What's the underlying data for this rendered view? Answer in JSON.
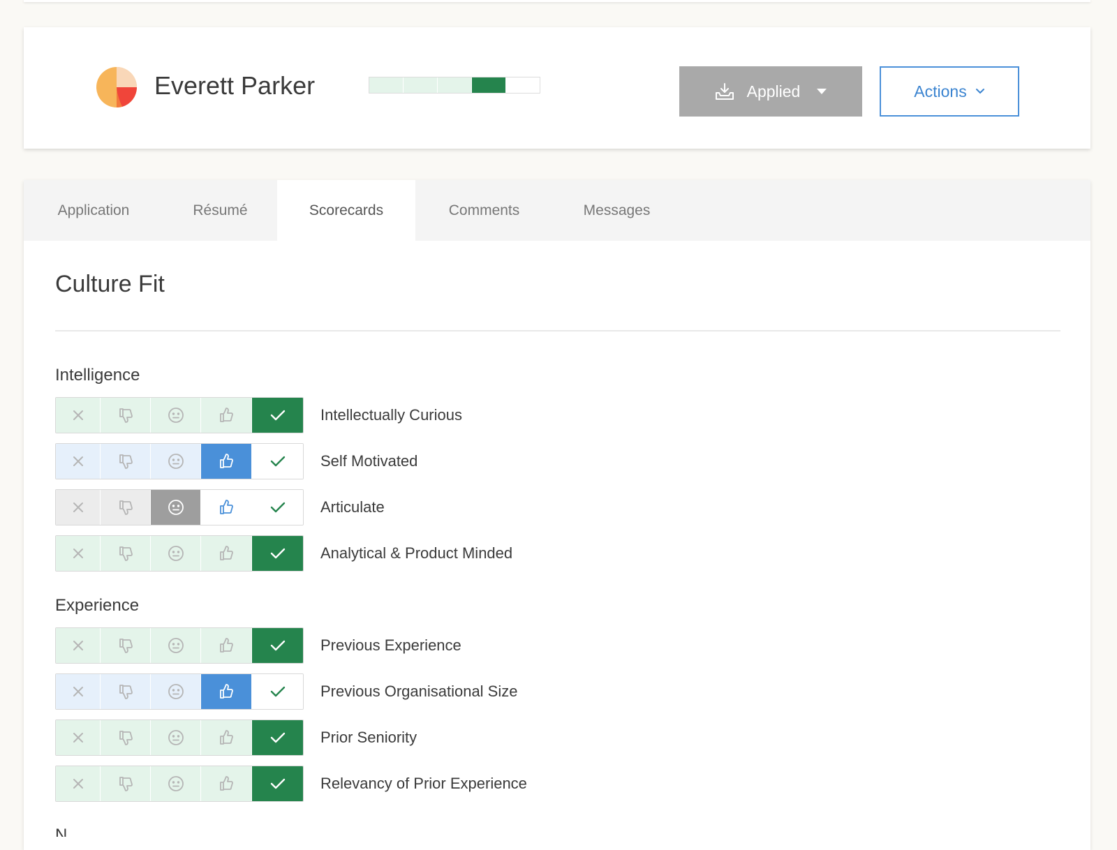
{
  "candidate": {
    "name": "Everett Parker",
    "pipeline_progress": {
      "total_stages": 5,
      "completed_stages": 3,
      "current_stage": 4
    }
  },
  "header": {
    "status_button": {
      "label": "Applied",
      "icon": "inbox-download-icon"
    },
    "actions_button": {
      "label": "Actions",
      "icon": "chevron-down-icon"
    }
  },
  "tabs": [
    {
      "label": "Application",
      "active": false
    },
    {
      "label": "Résumé",
      "active": false
    },
    {
      "label": "Scorecards",
      "active": true
    },
    {
      "label": "Comments",
      "active": false
    },
    {
      "label": "Messages",
      "active": false
    }
  ],
  "scorecard": {
    "title": "Culture Fit",
    "rating_scale": [
      "definitely-not",
      "no",
      "neutral",
      "yes",
      "strong-yes"
    ],
    "groups": [
      {
        "title": "Intelligence",
        "items": [
          {
            "label": "Intellectually Curious",
            "rating": "strong-yes"
          },
          {
            "label": "Self Motivated",
            "rating": "yes"
          },
          {
            "label": "Articulate",
            "rating": "neutral"
          },
          {
            "label": "Analytical & Product Minded",
            "rating": "strong-yes"
          }
        ]
      },
      {
        "title": "Experience",
        "items": [
          {
            "label": "Previous Experience",
            "rating": "strong-yes"
          },
          {
            "label": "Previous Organisational Size",
            "rating": "yes"
          },
          {
            "label": "Prior Seniority",
            "rating": "strong-yes"
          },
          {
            "label": "Relevancy of Prior Experience",
            "rating": "strong-yes"
          }
        ]
      }
    ],
    "next_group_title_partial": "N"
  },
  "colors": {
    "strong_yes": "#25844d",
    "strong_yes_tint": "#e4f4ea",
    "yes": "#4a90d9",
    "yes_tint": "#e6f0fb",
    "neutral": "#9e9e9e",
    "neutral_tint": "#ececec",
    "accent_blue": "#3b84d0"
  }
}
